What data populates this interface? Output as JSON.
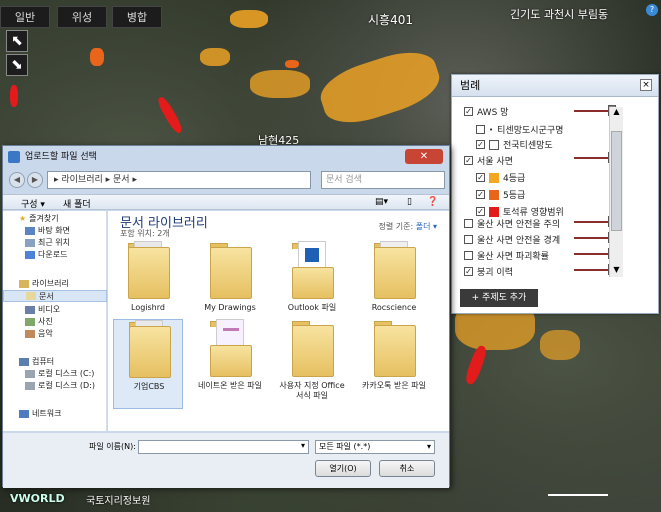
{
  "map": {
    "tabs": [
      "일반",
      "위성",
      "병합"
    ],
    "labels": {
      "top_center": "시흥401",
      "top_right": "긴기도 과천시 부림동",
      "mid": "남현425",
      "vworld_logo": "VWORLD",
      "bottom_logo": "국토지리정보원"
    },
    "nav_icons": [
      "pan-arrow-icon",
      "pan-arrow-icon"
    ]
  },
  "legend": {
    "title": "범례",
    "close": "×",
    "items": [
      {
        "label": "AWS 망",
        "checked": true,
        "indent": 0
      },
      {
        "label": "티센망도시군구명",
        "checked": false,
        "indent": 1
      },
      {
        "label": "전국티센망도",
        "checked": true,
        "indent": 1
      },
      {
        "label": "서울 사면",
        "checked": true,
        "indent": 0
      },
      {
        "label": "4등급",
        "checked": true,
        "indent": 1,
        "color": "#f5a623"
      },
      {
        "label": "5등급",
        "checked": true,
        "indent": 1,
        "color": "#e8651a"
      },
      {
        "label": "토석류 영향범위",
        "checked": true,
        "indent": 1,
        "color": "#e31b1b"
      },
      {
        "label": "울산 사면 안전을 주의",
        "checked": false,
        "indent": 0
      },
      {
        "label": "울산 사면 안전을 경계",
        "checked": false,
        "indent": 0
      },
      {
        "label": "울산 사면 파괴확률",
        "checked": false,
        "indent": 0
      },
      {
        "label": "붕괴 이력",
        "checked": true,
        "indent": 0
      }
    ],
    "add_button": "+ 주제도 추가"
  },
  "dialog": {
    "title": "업로드할 파일 선택",
    "close": "✕",
    "breadcrumb": "▸ 라이브러리 ▸ 문서 ▸",
    "search_placeholder": "문서 검색",
    "toolbar": {
      "organize": "구성 ▾",
      "new_folder": "새 폴더"
    },
    "sidebar": {
      "favorites_header": "즐겨찾기",
      "favorites": [
        "바탕 화면",
        "최근 위치",
        "다운로드"
      ],
      "libraries_header": "라이브러리",
      "libraries": [
        "문서",
        "비디오",
        "사진",
        "음악"
      ],
      "computer_header": "컴퓨터",
      "computer": [
        "로컬 디스크 (C:)",
        "로컬 디스크 (D:)"
      ],
      "network": "네트워크"
    },
    "library": {
      "title": "문서 라이브러리",
      "subtitle": "포함 위치: 2개",
      "sort_label": "정렬 기준:",
      "sort_value": "폴더 ▾"
    },
    "folders": [
      "Logishrd",
      "My Drawings",
      "Outlook 파일",
      "Rocscience",
      "기업CBS",
      "네이트온 받은 파일",
      "사용자 지정 Office 서식 파일",
      "카카오톡 받은 파일"
    ],
    "filename_label": "파일 이름(N):",
    "filetype_value": "모든 파일 (*.*)",
    "open_button": "열기(O)",
    "cancel_button": "취소"
  }
}
